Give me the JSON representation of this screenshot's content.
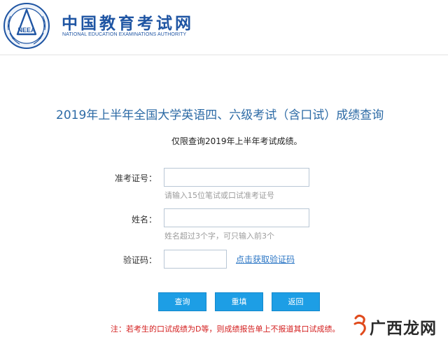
{
  "header": {
    "logo_text": "NEEA",
    "brand_cn": "中国教育考试网",
    "brand_en": "NATIONAL EDUCATION EXAMINATIONS AUTHORITY"
  },
  "main": {
    "title": "2019年上半年全国大学英语四、六级考试（含口试）成绩查询",
    "notice": "仅限查询2019年上半年考试成绩。"
  },
  "form": {
    "exam_id": {
      "label": "准考证号：",
      "value": "",
      "hint": "请输入15位笔试或口试准考证号"
    },
    "name": {
      "label": "姓名：",
      "value": "",
      "hint": "姓名超过3个字，可只输入前3个"
    },
    "captcha": {
      "label": "验证码：",
      "value": "",
      "link_text": "点击获取验证码"
    }
  },
  "buttons": {
    "query": "查询",
    "reset": "重填",
    "back": "返回"
  },
  "footnote": "注：若考生的口试成绩为D等，则成绩报告单上不报道其口试成绩。",
  "watermark": {
    "text": "广西龙网"
  },
  "colors": {
    "brand_blue": "#1f55a3",
    "title_blue": "#2c6aa5",
    "button_blue": "#1d9ee5",
    "link_blue": "#2b76c5",
    "alert_red": "#d42020"
  }
}
